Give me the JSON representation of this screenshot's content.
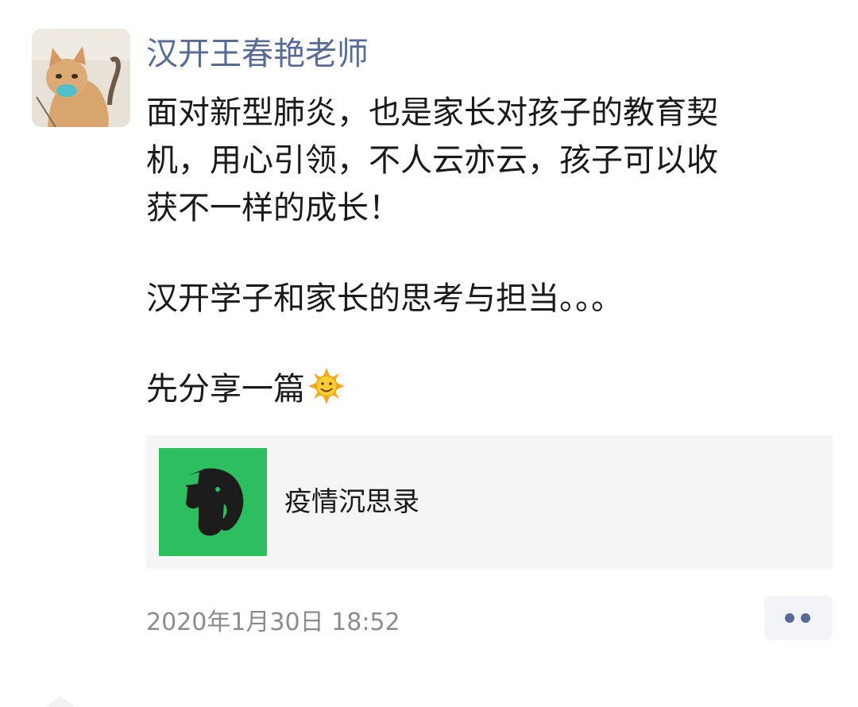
{
  "post": {
    "author": "汉开王春艳老师",
    "lines": [
      "面对新型肺炎，也是家长对孩子的教育契",
      "机，用心引领，不人云亦云，孩子可以收",
      "获不一样的成长！",
      "汉开学子和家长的思考与担当。。。",
      "先分享一篇"
    ],
    "emoji_icon": "sun-smiley-icon",
    "link": {
      "title": "疫情沉思录",
      "icon": "evernote-elephant-icon",
      "icon_bg": "#2dbe60"
    },
    "timestamp": "2020年1月30日 18:52",
    "more_icon": "more-dots-icon"
  },
  "colors": {
    "author": "#576b95",
    "text": "#1a1a1a",
    "timestamp": "#8c8c8c",
    "card_bg": "#f5f5f5"
  }
}
